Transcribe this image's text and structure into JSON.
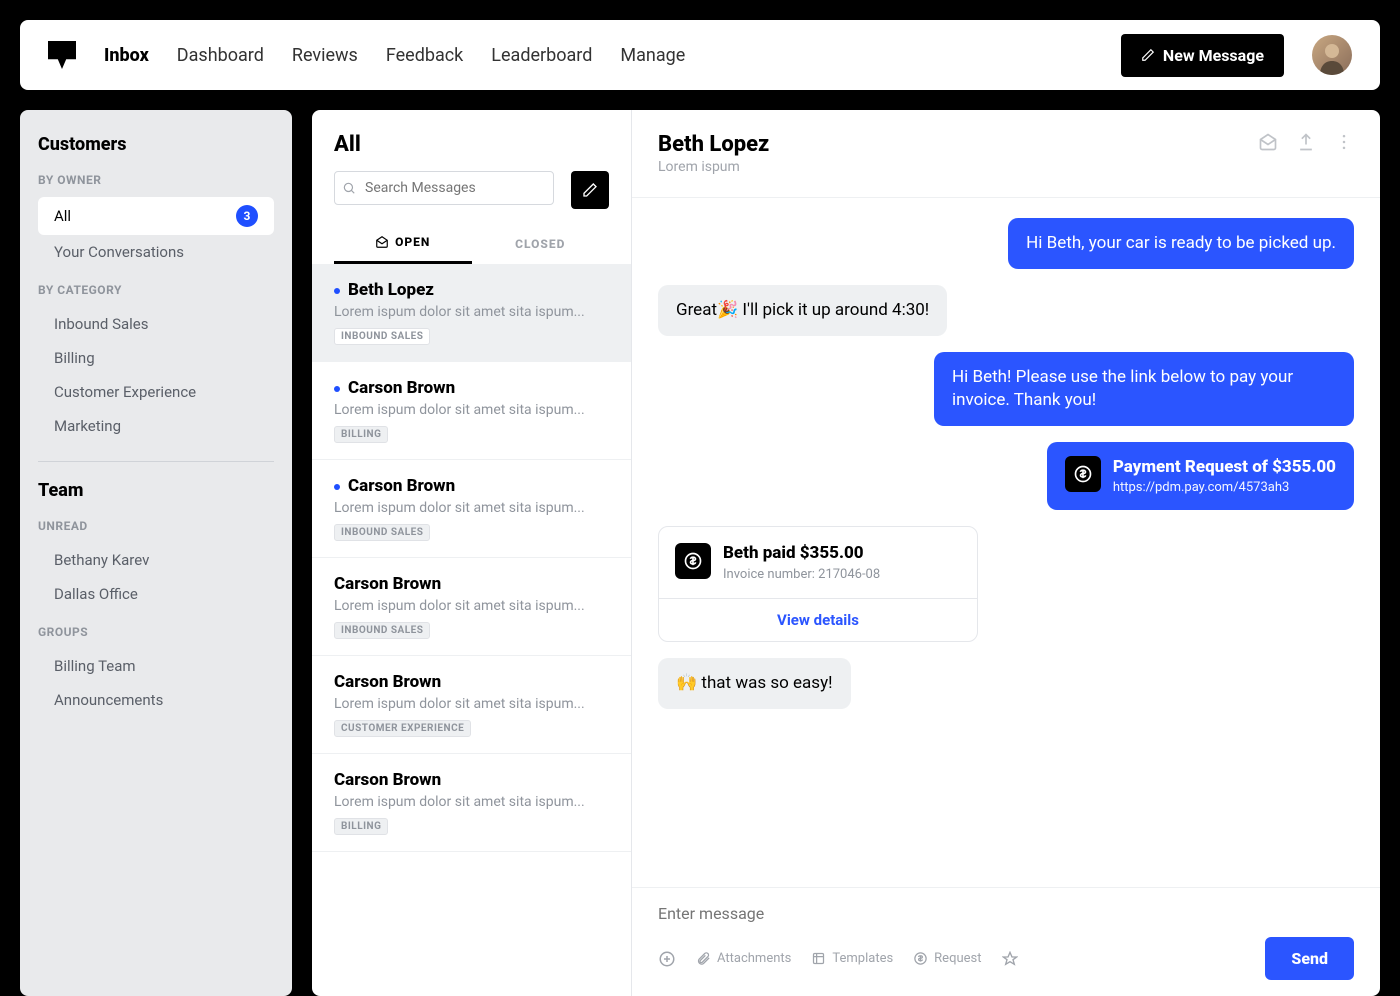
{
  "nav": {
    "items": [
      "Inbox",
      "Dashboard",
      "Reviews",
      "Feedback",
      "Leaderboard",
      "Manage"
    ],
    "active": "Inbox",
    "new_message": "New Message"
  },
  "sidebar": {
    "customers_title": "Customers",
    "by_owner_label": "BY OWNER",
    "owner_items": [
      {
        "label": "All",
        "badge": "3",
        "active": true
      },
      {
        "label": "Your Conversations"
      }
    ],
    "by_category_label": "BY CATEGORY",
    "category_items": [
      {
        "label": "Inbound Sales"
      },
      {
        "label": "Billing"
      },
      {
        "label": "Customer Experience"
      },
      {
        "label": "Marketing"
      }
    ],
    "team_title": "Team",
    "unread_label": "UNREAD",
    "unread_items": [
      {
        "label": "Bethany Karev"
      },
      {
        "label": "Dallas Office"
      }
    ],
    "groups_label": "GROUPS",
    "group_items": [
      {
        "label": "Billing Team"
      },
      {
        "label": "Announcements"
      }
    ]
  },
  "list": {
    "title": "All",
    "search_placeholder": "Search Messages",
    "tabs": {
      "open": "OPEN",
      "closed": "CLOSED",
      "active": "open"
    },
    "items": [
      {
        "name": "Beth Lopez",
        "preview": "Lorem ispum dolor sit amet sita ispum...",
        "tag": "INBOUND SALES",
        "unread": true,
        "selected": true
      },
      {
        "name": "Carson Brown",
        "preview": "Lorem ispum dolor sit amet sita ispum...",
        "tag": "BILLING",
        "unread": true
      },
      {
        "name": "Carson Brown",
        "preview": "Lorem ispum dolor sit amet sita ispum...",
        "tag": "INBOUND SALES",
        "unread": true
      },
      {
        "name": "Carson Brown",
        "preview": "Lorem ispum dolor sit amet sita ispum...",
        "tag": "INBOUND SALES"
      },
      {
        "name": "Carson Brown",
        "preview": "Lorem ispum dolor sit amet sita ispum...",
        "tag": "CUSTOMER EXPERIENCE"
      },
      {
        "name": "Carson Brown",
        "preview": "Lorem ispum dolor sit amet sita ispum...",
        "tag": "BILLING"
      }
    ]
  },
  "convo": {
    "name": "Beth Lopez",
    "subtitle": "Lorem ispum",
    "messages": [
      {
        "dir": "out",
        "text": "Hi Beth, your car is ready to be picked up."
      },
      {
        "dir": "in",
        "text": "Great🎉 I'll pick it up around 4:30!"
      },
      {
        "dir": "out",
        "text": "Hi Beth! Please use the link below to pay your invoice. Thank you!"
      },
      {
        "dir": "out",
        "type": "payreq",
        "title": "Payment Request of $355.00",
        "link": "https://pdm.pay.com/4573ah3"
      },
      {
        "type": "receipt",
        "title": "Beth paid $355.00",
        "sub": "Invoice number: 217046-08",
        "cta": "View details"
      },
      {
        "dir": "in",
        "text": "🙌 that was so easy!"
      }
    ],
    "composer": {
      "placeholder": "Enter message",
      "attachments": "Attachments",
      "templates": "Templates",
      "request": "Request",
      "send": "Send"
    }
  }
}
